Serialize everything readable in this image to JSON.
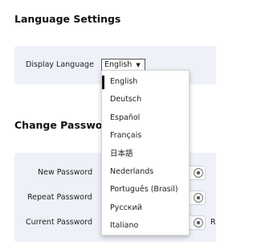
{
  "language_settings": {
    "title": "Language Settings",
    "display_language_label": "Display Language",
    "selected_language": "English",
    "dropdown_arrow": "▼",
    "options": [
      "English",
      "Deutsch",
      "Español",
      "Français",
      "日本語",
      "Nederlands",
      "Português (Brasil)",
      "Русский",
      "Italiano"
    ]
  },
  "change_password": {
    "title": "Change Passwo",
    "new_password_label": "New Password",
    "repeat_password_label": "Repeat Password",
    "current_password_label": "Current Password",
    "trailing_label": "R"
  },
  "icons": {
    "eye": "eye-icon",
    "dropdown": "triangle-down-icon"
  }
}
